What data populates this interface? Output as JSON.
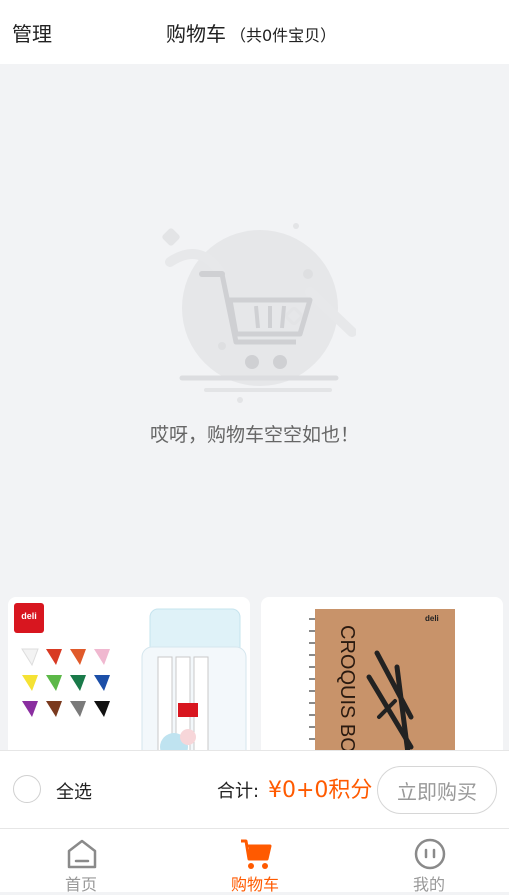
{
  "header": {
    "manage_label": "管理",
    "title": "购物车",
    "count_text": "（共0件宝贝）"
  },
  "empty_state": {
    "message": "哎呀，购物车空空如也！"
  },
  "recommendations": {
    "items": [
      {
        "brand": "deli",
        "image": "marker-pen-set"
      },
      {
        "brand": "deli",
        "image": "croquis-sketchbook",
        "cover_text": "CROQUIS BOO"
      }
    ]
  },
  "checkout": {
    "select_all_label": "全选",
    "total_label": "合计:",
    "total_value": "¥0+0积分",
    "buy_label": "立即购买"
  },
  "tabbar": {
    "tabs": [
      {
        "label": "首页",
        "icon": "home-icon",
        "active": false
      },
      {
        "label": "购物车",
        "icon": "cart-icon",
        "active": true
      },
      {
        "label": "我的",
        "icon": "profile-icon",
        "active": false
      }
    ]
  },
  "colors": {
    "accent": "#ff5a00",
    "background": "#f2f3f5"
  }
}
